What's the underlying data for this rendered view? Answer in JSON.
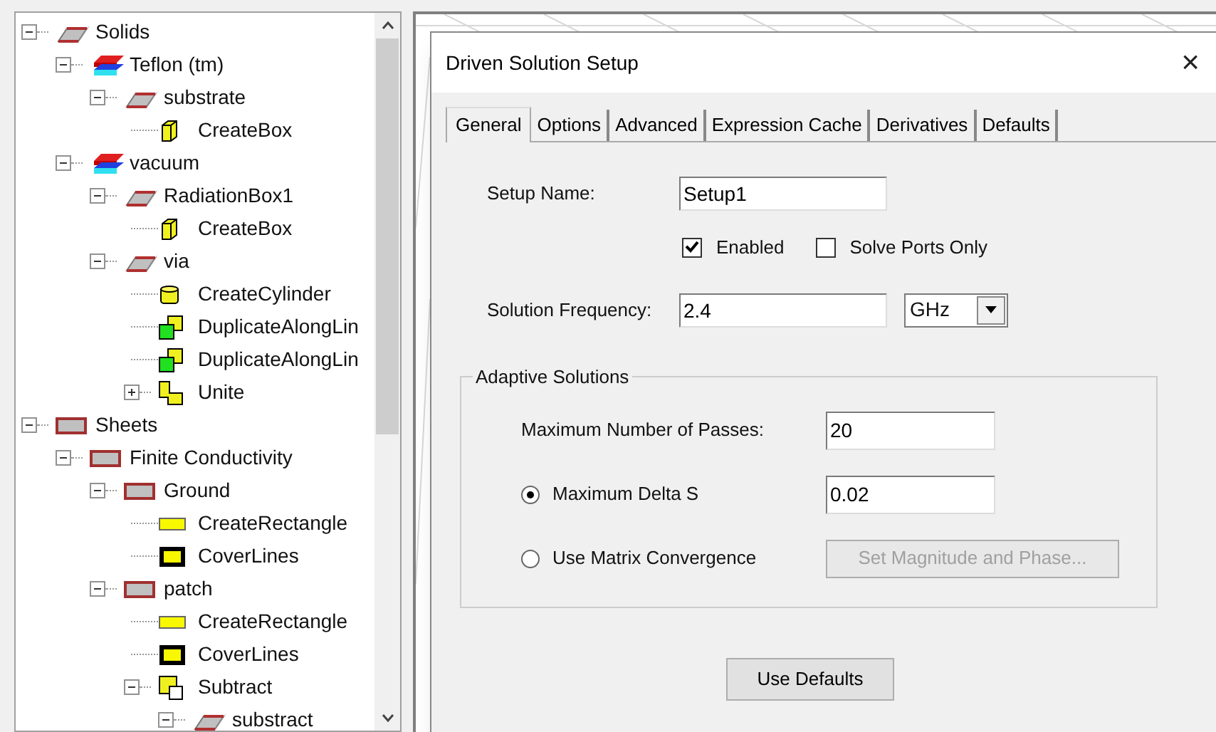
{
  "tree": [
    {
      "label": "Solids",
      "kind": "solid",
      "expanded": true,
      "children": [
        {
          "label": "Teflon (tm)",
          "kind": "material",
          "expanded": true,
          "children": [
            {
              "label": "substrate",
              "kind": "solid",
              "expanded": true,
              "children": [
                {
                  "label": "CreateBox",
                  "kind": "box"
                }
              ]
            }
          ]
        },
        {
          "label": "vacuum",
          "kind": "material",
          "expanded": true,
          "children": [
            {
              "label": "RadiationBox1",
              "kind": "solid",
              "expanded": true,
              "children": [
                {
                  "label": "CreateBox",
                  "kind": "box"
                }
              ]
            },
            {
              "label": "via",
              "kind": "solid",
              "expanded": true,
              "children": [
                {
                  "label": "CreateCylinder",
                  "kind": "cylinder"
                },
                {
                  "label": "DuplicateAlongLin",
                  "kind": "duplicate"
                },
                {
                  "label": "DuplicateAlongLin",
                  "kind": "duplicate"
                },
                {
                  "label": "Unite",
                  "kind": "unite",
                  "expanded": false
                }
              ]
            }
          ]
        }
      ]
    },
    {
      "label": "Sheets",
      "kind": "sheet",
      "expanded": true,
      "children": [
        {
          "label": "Finite Conductivity",
          "kind": "sheet",
          "expanded": true,
          "children": [
            {
              "label": "Ground",
              "kind": "sheet",
              "expanded": true,
              "children": [
                {
                  "label": "CreateRectangle",
                  "kind": "rectangle"
                },
                {
                  "label": "CoverLines",
                  "kind": "cover"
                }
              ]
            },
            {
              "label": "patch",
              "kind": "sheet",
              "expanded": true,
              "children": [
                {
                  "label": "CreateRectangle",
                  "kind": "rectangle"
                },
                {
                  "label": "CoverLines",
                  "kind": "cover"
                },
                {
                  "label": "Subtract",
                  "kind": "subtract",
                  "expanded": true,
                  "children": [
                    {
                      "label": "substract",
                      "kind": "solid",
                      "expanded": true
                    }
                  ]
                }
              ]
            }
          ]
        }
      ]
    }
  ],
  "dialog": {
    "title": "Driven Solution Setup",
    "close": "×",
    "tabs": [
      {
        "label": "General",
        "selected": true
      },
      {
        "label": "Options",
        "selected": false
      },
      {
        "label": "Advanced",
        "selected": false
      },
      {
        "label": "Expression Cache",
        "selected": false
      },
      {
        "label": "Derivatives",
        "selected": false
      },
      {
        "label": "Defaults",
        "selected": false
      }
    ],
    "setup_name": {
      "label": "Setup Name:",
      "value": "Setup1"
    },
    "checkboxes": [
      {
        "label": "Enabled",
        "checked": true
      },
      {
        "label": "Solve Ports Only",
        "checked": false
      }
    ],
    "frequency": {
      "label": "Solution Frequency:",
      "value": "2.4",
      "unit": "GHz"
    },
    "adaptive": {
      "title": "Adaptive Solutions",
      "passes": {
        "label": "Maximum Number of Passes:",
        "value": "20"
      },
      "options": [
        {
          "label": "Maximum Delta S",
          "selected": true,
          "kind": "field",
          "value": "0.02"
        },
        {
          "label": "Use Matrix Convergence",
          "selected": false,
          "kind": "button",
          "button": "Set Magnitude and Phase...",
          "disabled": true
        }
      ]
    },
    "use_defaults": "Use Defaults"
  }
}
